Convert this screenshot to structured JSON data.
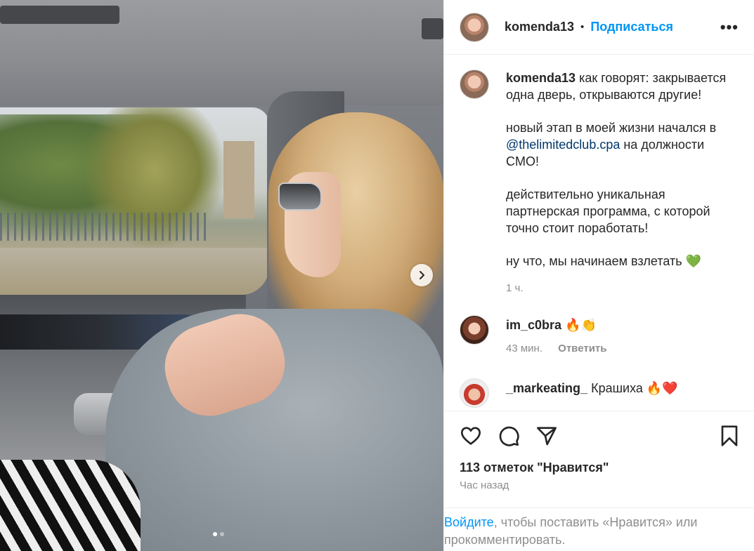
{
  "post": {
    "author": "komenda13",
    "separator": "•",
    "follow_label": "Подписаться",
    "more_label": "•••"
  },
  "caption": {
    "author": "komenda13",
    "line1": "как говорят: закрывается одна дверь, открываются другие!",
    "p2_before": "новый этап в моей жизни начался в ",
    "p2_mention": "@thelimitedclub.cpa",
    "p2_after": " на должности CMO!",
    "p3": "действительно уникальная партнерская программа, с которой точно стоит поработать!",
    "p4": "ну что, мы начинаем взлетать 💚",
    "time": "1 ч."
  },
  "comments": [
    {
      "user": "im_c0bra",
      "text": "🔥👏",
      "time": "43 мин.",
      "reply_label": "Ответить"
    },
    {
      "user": "_markeating_",
      "text": "Крашиха 🔥❤️"
    }
  ],
  "likes_text": "113 отметок \"Нравится\"",
  "posted_text": "Час назад",
  "login": {
    "link": "Войдите",
    "rest": ", чтобы поставить «Нравится» или прокомментировать."
  },
  "icons": {
    "like": "heart-icon",
    "comment": "comment-icon",
    "share": "paper-plane-icon",
    "save": "bookmark-icon",
    "next": "chevron-right-icon"
  },
  "colors": {
    "accent": "#0095f6",
    "mention": "#00376b",
    "muted": "#8e8e8e"
  },
  "carousel": {
    "slides": 2,
    "current": 1
  }
}
